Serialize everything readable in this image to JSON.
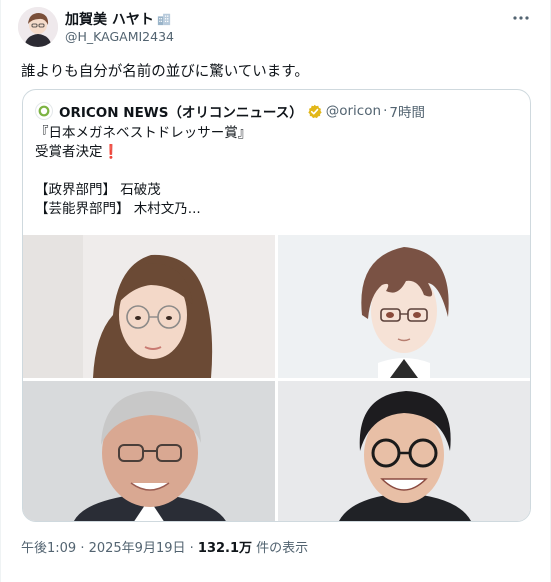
{
  "author": {
    "display_name": "加賀美 ハヤト",
    "handle": "@H_KAGAMI2434",
    "badge_icon": "office-building-icon"
  },
  "more_icon": "more-options-icon",
  "tweet": {
    "text": "誰よりも自分が名前の並びに驚いています。"
  },
  "quote": {
    "name": "ORICON NEWS（オリコンニュース）",
    "verified_icon": "verified-gold-badge-icon",
    "handle": "@oricon",
    "separator": "·",
    "time": "7時間",
    "lines": [
      "『日本メガネベストドレッサー賞』",
      "受賞者決定",
      "",
      "【政界部門】 石破茂",
      "【芸能界部門】 木村文乃..."
    ],
    "exclamation": "❗",
    "images": [
      {
        "name": "photo-woman-glasses"
      },
      {
        "name": "illustration-anime-glasses"
      },
      {
        "name": "photo-man-gray-hair"
      },
      {
        "name": "photo-man-round-glasses"
      }
    ]
  },
  "meta": {
    "timestamp": "午後1:09 · 2025年9月19日",
    "dot": " · ",
    "views_count": "132.1万",
    "views_label": " 件の表示"
  },
  "colors": {
    "text": "#0f1419",
    "secondary": "#536471",
    "border": "#cfd9de",
    "verified_gold": "#e2b719",
    "oricon_green": "#7cb342"
  }
}
